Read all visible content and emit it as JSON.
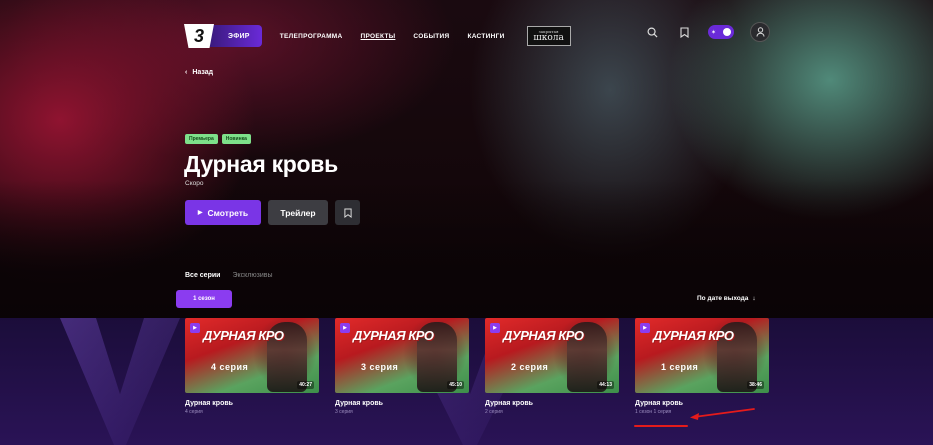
{
  "header": {
    "logo_label": "3",
    "live_label": "ЭФИР",
    "nav": [
      "ТЕЛЕПРОГРАММА",
      "ПРОЕКТЫ",
      "СОБЫТИЯ",
      "КАСТИНГИ"
    ],
    "active_nav": "ПРОЕКТЫ",
    "school_logo": {
      "top": "закрытая",
      "bottom": "школа"
    }
  },
  "back_label": "Назад",
  "hero": {
    "tags": [
      "Премьера",
      "Новинка"
    ],
    "title": "Дурная кровь",
    "subtitle": "Скоро",
    "watch_label": "Смотреть",
    "trailer_label": "Трейлер"
  },
  "tabs": [
    {
      "label": "Все серии",
      "active": true
    },
    {
      "label": "Эксклюзивы",
      "active": false
    }
  ],
  "season_label": "1 сезон",
  "sort_label": "По дате выхода",
  "cards": [
    {
      "logo": "ДУРНАЯ КРО",
      "episode": "4 серия",
      "duration": "40:27",
      "title": "Дурная кровь",
      "sub": "4 серия"
    },
    {
      "logo": "ДУРНАЯ КРО",
      "episode": "3 серия",
      "duration": "45:10",
      "title": "Дурная кровь",
      "sub": "3 серия"
    },
    {
      "logo": "ДУРНАЯ КРО",
      "episode": "2 серия",
      "duration": "44:13",
      "title": "Дурная кровь",
      "sub": "2 серия"
    },
    {
      "logo": "ДУРНАЯ КРО",
      "episode": "1 серия",
      "duration": "38:46",
      "title": "Дурная кровь",
      "sub": "1 сезон 1 серия"
    }
  ],
  "colors": {
    "accent": "#7a35e6",
    "tag": "#7ee08a",
    "annotation": "#e51b1b"
  },
  "icons": [
    "search-icon",
    "bookmark-icon",
    "theme-toggle-icon",
    "profile-icon",
    "chevron-left-icon",
    "play-icon",
    "arrow-down-icon"
  ]
}
